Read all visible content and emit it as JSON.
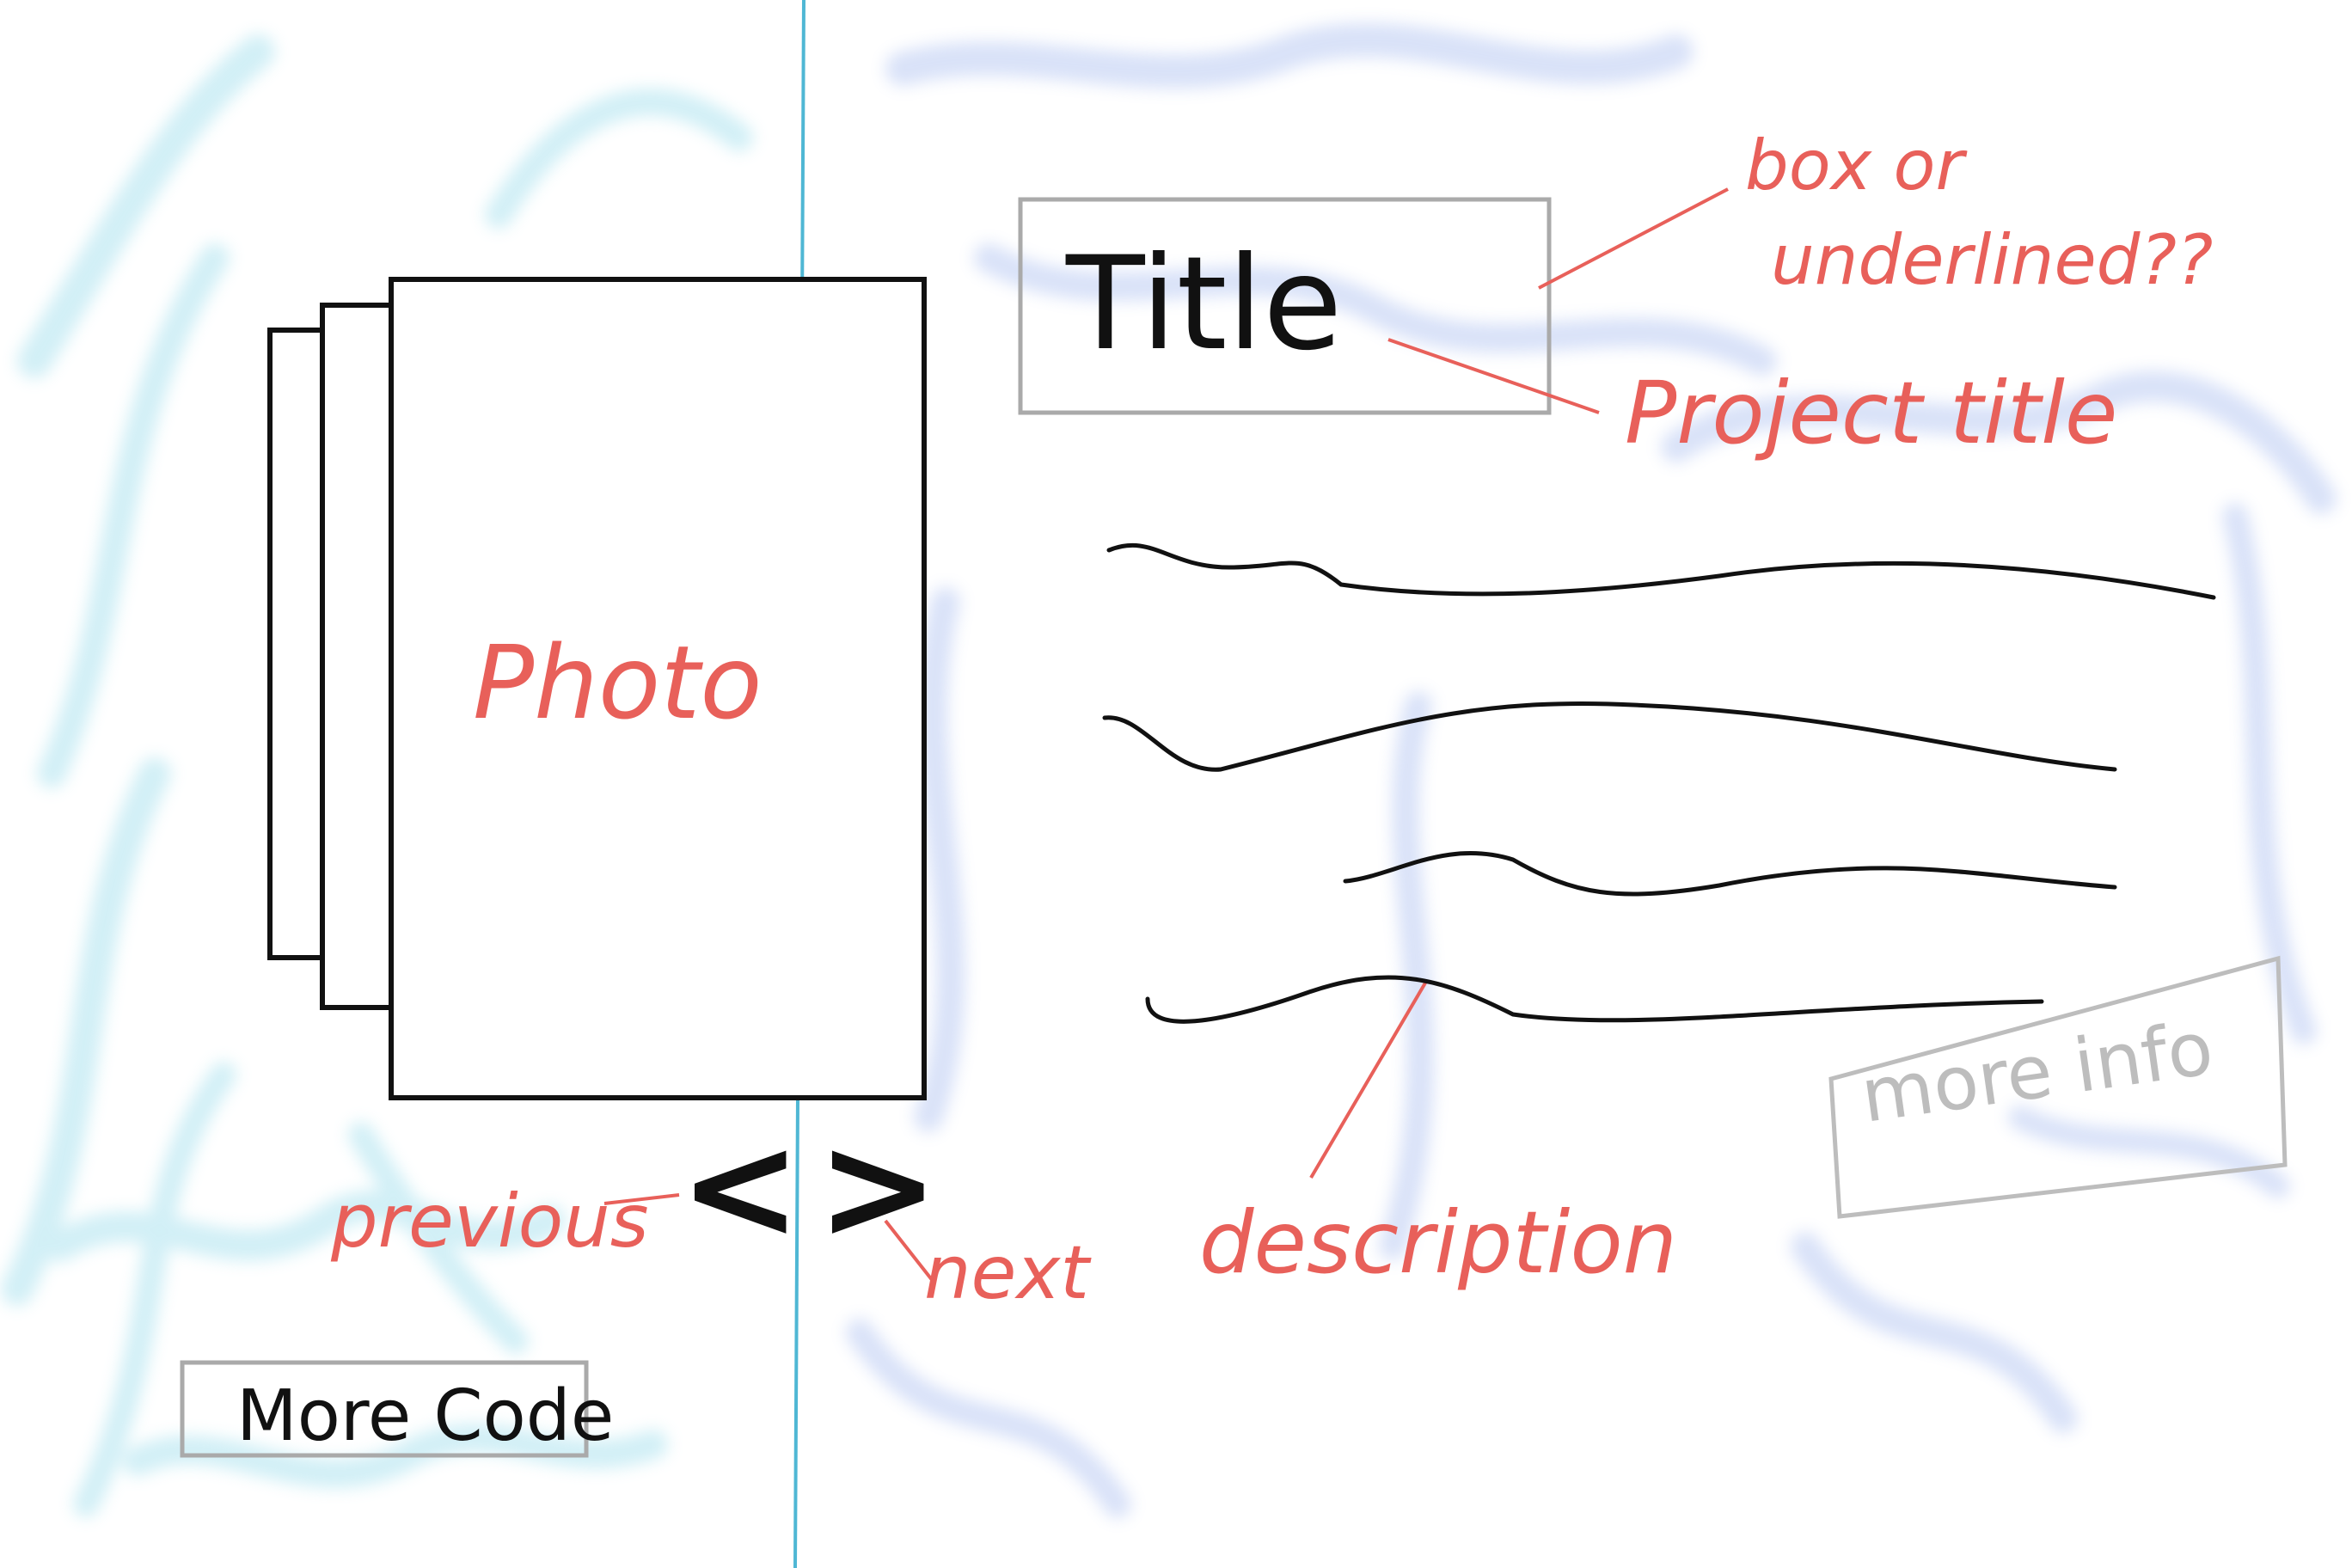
{
  "sketch": {
    "title_box": {
      "text": "Title"
    },
    "photo": {
      "label": "Photo"
    },
    "nav": {
      "prev_glyph": "<",
      "next_glyph": ">",
      "prev_note": "previous",
      "next_note": "next"
    },
    "annotations": {
      "title_style_line1": "box or",
      "title_style_line2": "underlined??",
      "project_title": "Project title",
      "description": "description"
    },
    "buttons": {
      "more_code": "More Code",
      "more_info": "more info"
    },
    "colors": {
      "ink": "#111111",
      "annotation": "#e8605a",
      "faded": "#b5b5b5",
      "divider": "#4fb7d4",
      "left_wash": "#7fd3e6",
      "right_wash": "#8aa6ea"
    }
  }
}
